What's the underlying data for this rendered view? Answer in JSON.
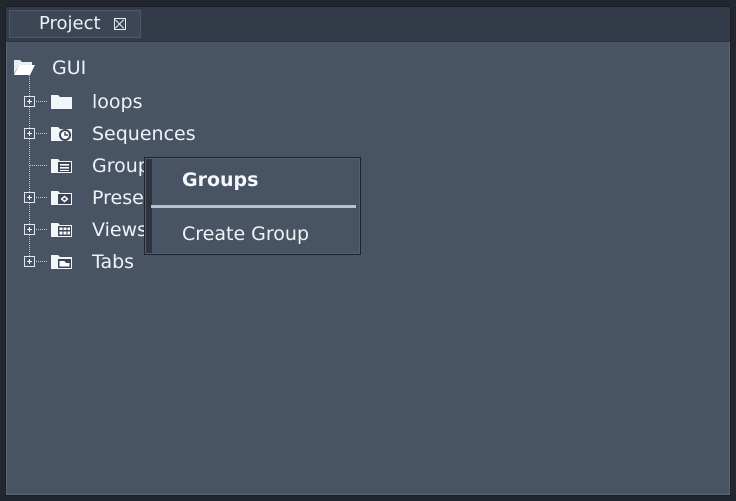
{
  "tab": {
    "label": "Project"
  },
  "tree": {
    "root": {
      "label": "GUI"
    },
    "items": [
      {
        "label": "loops"
      },
      {
        "label": "Sequences"
      },
      {
        "label": "Groups"
      },
      {
        "label": "Presets"
      },
      {
        "label": "Views"
      },
      {
        "label": "Tabs"
      }
    ]
  },
  "context_menu": {
    "title": "Groups",
    "items": [
      {
        "label": "Create Group"
      }
    ]
  },
  "colors": {
    "panel": "#485364",
    "tab_bar": "#333b48",
    "text": "#eef2f6",
    "folder_icon": "#f3f6f9"
  }
}
